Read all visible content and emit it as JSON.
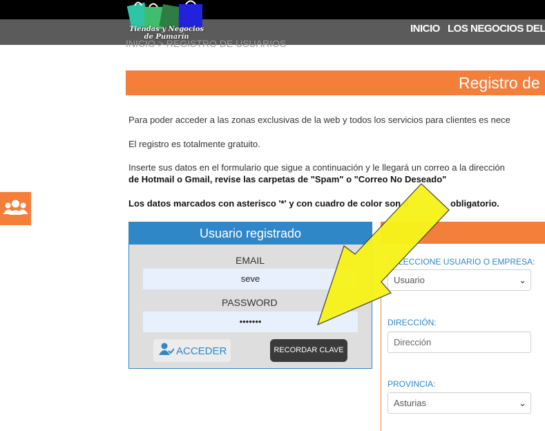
{
  "header": {
    "logo_line1": "Tiendas y Negocios",
    "logo_line2": "de Pumarín",
    "nav": [
      "INICIO",
      "LOS NEGOCIOS DEL BA"
    ]
  },
  "breadcrumb": {
    "home": "INICIO",
    "separator": ">",
    "current": "REGISTRO DE USUARIOS"
  },
  "banner": {
    "title": "Registro de"
  },
  "intro": {
    "p1": "Para poder acceder a las zonas exclusivas de la web y todos los servicios para clientes es nece",
    "p2": "El registro es totalmente gratuito.",
    "p3a": "Inserte sus datos en el formulario que sigue a continuación y le llegará un correo a la dirección",
    "p3b": "de Hotmail o Gmail, revise las carpetas de \"Spam\" o \"Correo No Deseado\"",
    "p4a": "Los datos marcados con asterisco '*' y con cuadro de color son d",
    "p4b": "obligatorio."
  },
  "login": {
    "title": "Usuario registrado",
    "email_label": "EMAIL",
    "email_value": "seve",
    "password_label": "PASSWORD",
    "password_value": "•••••••",
    "acceder_label": "ACCEDER",
    "recordar_label": "RECORDAR CLAVE"
  },
  "register": {
    "tipo_label": "SELECCIONE USUARIO O EMPRESA:",
    "tipo_value": "Usuario",
    "direccion_label": "DIRECCIÓN:",
    "direccion_placeholder": "Dirección",
    "provincia_label": "PROVINCIA:",
    "provincia_value": "Asturias"
  },
  "colors": {
    "accent": "#f47f3b",
    "blue": "#2f87c7",
    "nav": "#5b5b5b",
    "arrow": "#f7f31c"
  }
}
